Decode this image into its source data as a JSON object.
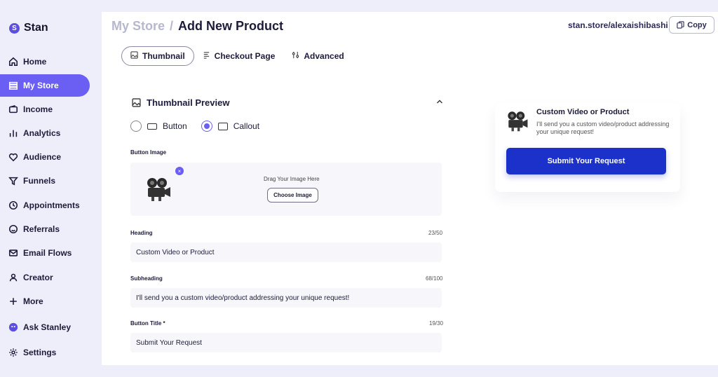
{
  "brand": {
    "logo": "S",
    "name": "Stan"
  },
  "sidebar": {
    "items": [
      {
        "label": "Home",
        "icon": "home-icon"
      },
      {
        "label": "My Store",
        "icon": "store-icon",
        "active": true
      },
      {
        "label": "Income",
        "icon": "wallet-icon"
      },
      {
        "label": "Analytics",
        "icon": "bar-chart-icon"
      },
      {
        "label": "Audience",
        "icon": "heart-icon"
      },
      {
        "label": "Funnels",
        "icon": "funnel-icon"
      },
      {
        "label": "Appointments",
        "icon": "clock-icon"
      },
      {
        "label": "Referrals",
        "icon": "smile-icon"
      },
      {
        "label": "Email Flows",
        "icon": "mail-icon"
      },
      {
        "label": "Creator",
        "icon": "person-icon"
      },
      {
        "label": "More",
        "icon": "plus-icon"
      },
      {
        "label": "Ask Stanley",
        "icon": "stanley-avatar-icon"
      },
      {
        "label": "Settings",
        "icon": "gear-icon"
      }
    ]
  },
  "header": {
    "breadcrumb_parent": "My Store",
    "breadcrumb_sep": "/",
    "title": "Add New Product",
    "store_url": "stan.store/alexaishibashi",
    "copy_label": "Copy"
  },
  "tabs": [
    {
      "label": "Thumbnail",
      "active": true,
      "icon": "image-icon"
    },
    {
      "label": "Checkout Page",
      "active": false,
      "icon": "page-icon"
    },
    {
      "label": "Advanced",
      "active": false,
      "icon": "sliders-icon"
    }
  ],
  "thumbnail_section": {
    "title": "Thumbnail Preview",
    "style_options": [
      {
        "label": "Button",
        "selected": false
      },
      {
        "label": "Callout",
        "selected": true
      }
    ],
    "button_image_label": "Button Image",
    "drag_text": "Drag Your Image Here",
    "choose_image_label": "Choose Image",
    "heading": {
      "label": "Heading",
      "counter": "23/50",
      "value": "Custom Video or Product"
    },
    "subheading": {
      "label": "Subheading",
      "counter": "68/100",
      "value": "I'll send you a custom video/product addressing your unique request!"
    },
    "button_title": {
      "label": "Button Title *",
      "counter": "19/30",
      "value": "Submit Your Request"
    }
  },
  "preview": {
    "title": "Custom Video or Product",
    "subtitle": "I'll send you a custom video/product addressing your unique request!",
    "button_label": "Submit Your Request"
  },
  "colors": {
    "accent": "#6a5ff2",
    "button_blue": "#1b31c9",
    "background": "#eeedfa"
  }
}
